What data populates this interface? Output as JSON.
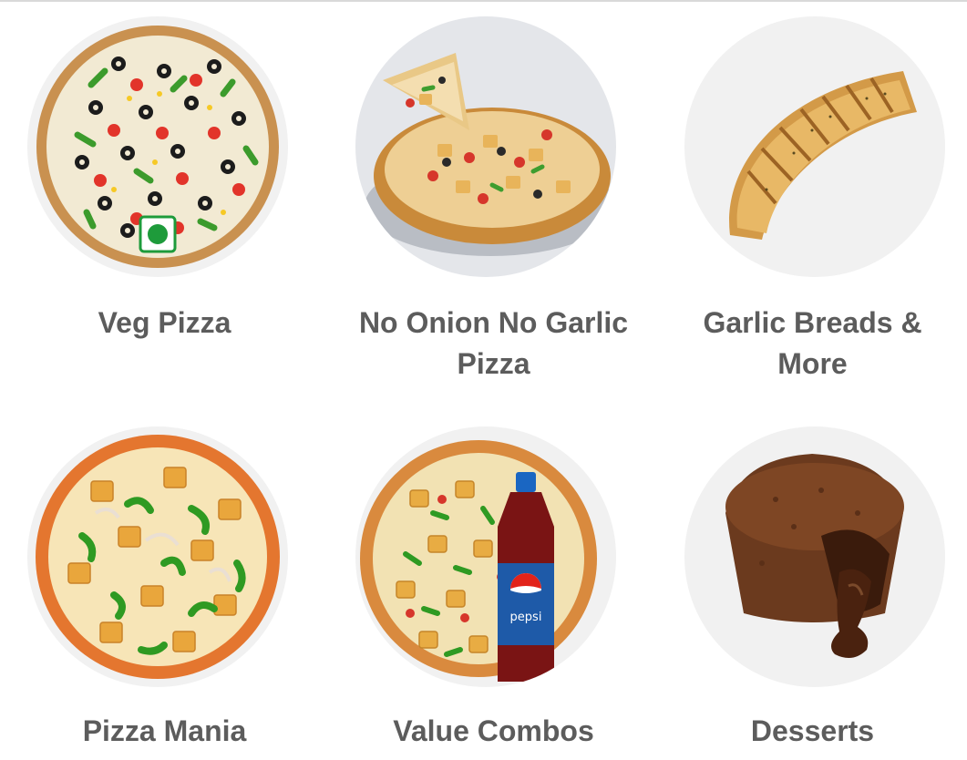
{
  "categories": [
    {
      "label": "Veg Pizza",
      "icon": "veg-pizza-image",
      "veg_mark": true
    },
    {
      "label": "No Onion No Garlic Pizza",
      "icon": "no-onion-pizza-image"
    },
    {
      "label": "Garlic Breads & More",
      "icon": "garlic-bread-image"
    },
    {
      "label": "Pizza Mania",
      "icon": "pizza-mania-image"
    },
    {
      "label": "Value Combos",
      "icon": "value-combo-image",
      "bottle_text": "pepsi"
    },
    {
      "label": "Desserts",
      "icon": "lava-cake-image"
    }
  ],
  "colors": {
    "label": "#5c5c5c",
    "disc": "#f1f1f1",
    "veg_green": "#1e9b3b",
    "pepsi_blue": "#1e5aa8",
    "cola": "#7a1414"
  }
}
